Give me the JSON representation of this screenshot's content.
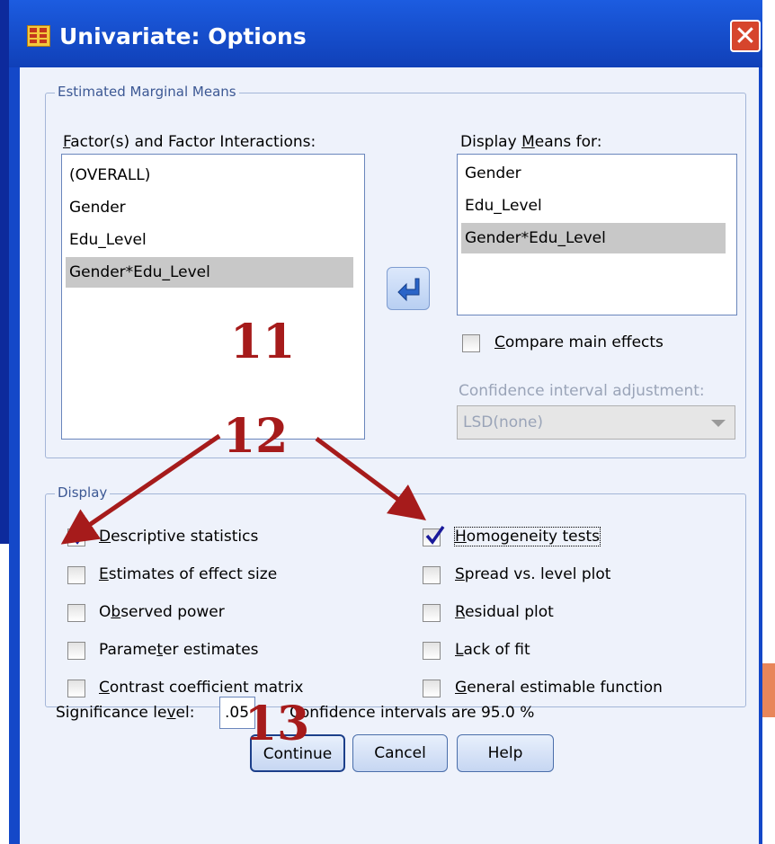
{
  "window": {
    "title": "Univariate: Options",
    "close_icon": "close-icon"
  },
  "emm": {
    "legend": "Estimated Marginal Means",
    "factors_label": "Factor(s) and Factor Interactions:",
    "factors_items": [
      "(OVERALL)",
      "Gender",
      "Edu_Level",
      "Gender*Edu_Level"
    ],
    "factors_selected_index": 3,
    "display_label": "Display Means for:",
    "display_items": [
      "Gender",
      "Edu_Level",
      "Gender*Edu_Level"
    ],
    "display_selected_index": 2,
    "move_icon": "arrow-back-icon",
    "compare_label": "Compare main effects",
    "compare_checked": false,
    "ci_adjust_label": "Confidence interval adjustment:",
    "ci_adjust_value": "LSD(none)"
  },
  "display": {
    "legend": "Display",
    "left": [
      {
        "label": "Descriptive statistics",
        "checked": true
      },
      {
        "label": "Estimates of effect size",
        "checked": false
      },
      {
        "label": "Observed power",
        "checked": false
      },
      {
        "label": "Parameter estimates",
        "checked": false
      },
      {
        "label": "Contrast coefficient matrix",
        "checked": false
      }
    ],
    "right": [
      {
        "label": "Homogeneity tests",
        "checked": true
      },
      {
        "label": "Spread vs. level plot",
        "checked": false
      },
      {
        "label": "Residual plot",
        "checked": false
      },
      {
        "label": "Lack of fit",
        "checked": false
      },
      {
        "label": "General estimable function",
        "checked": false
      }
    ]
  },
  "significance": {
    "label": "Significance level:",
    "value": ".05",
    "ci_text": "Confidence intervals are 95.0 %"
  },
  "buttons": {
    "continue": "Continue",
    "cancel": "Cancel",
    "help": "Help"
  },
  "annotations": {
    "a11": "11",
    "a12": "12",
    "a13": "13",
    "color": "#a61b1b"
  },
  "colors": {
    "titlebar": "#1448c8",
    "selection": "#c8c8c8",
    "client": "#eef2fb"
  }
}
